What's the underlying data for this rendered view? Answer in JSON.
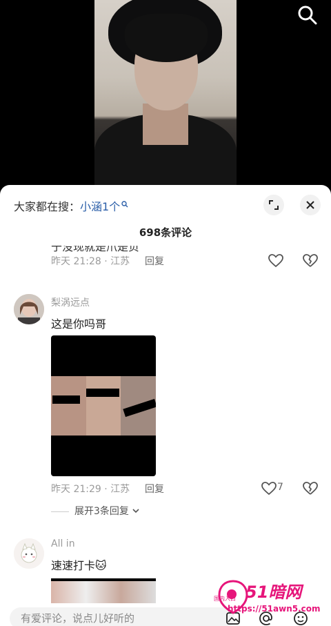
{
  "video": {
    "search_icon": "search-icon"
  },
  "sheet": {
    "trending_prefix": "大家都在搜：",
    "trending_keyword": "小涵1个",
    "comment_count": "698条评论",
    "buttons": {
      "expand_icon": "expand-icon",
      "close_icon": "close-icon"
    }
  },
  "comments": [
    {
      "cut_text": "于没现就是爪是负",
      "time": "昨天 21:28 · 江苏",
      "reply": "回复"
    },
    {
      "name": "梨涡远点",
      "text": "这是你吗哥",
      "time": "昨天 21:29 · 江苏",
      "reply": "回复",
      "likes": "7",
      "expand": "展开3条回复"
    },
    {
      "name": "All in",
      "text": "速速打卡🐱"
    }
  ],
  "input": {
    "placeholder": "有爱评论，说点儿好听的"
  },
  "watermark": {
    "text1": "51暗网",
    "text2": "https://51awn5.com",
    "small": "国内入口"
  },
  "colors": {
    "accent": "#2a5ea8",
    "watermark": "#e6157a"
  }
}
